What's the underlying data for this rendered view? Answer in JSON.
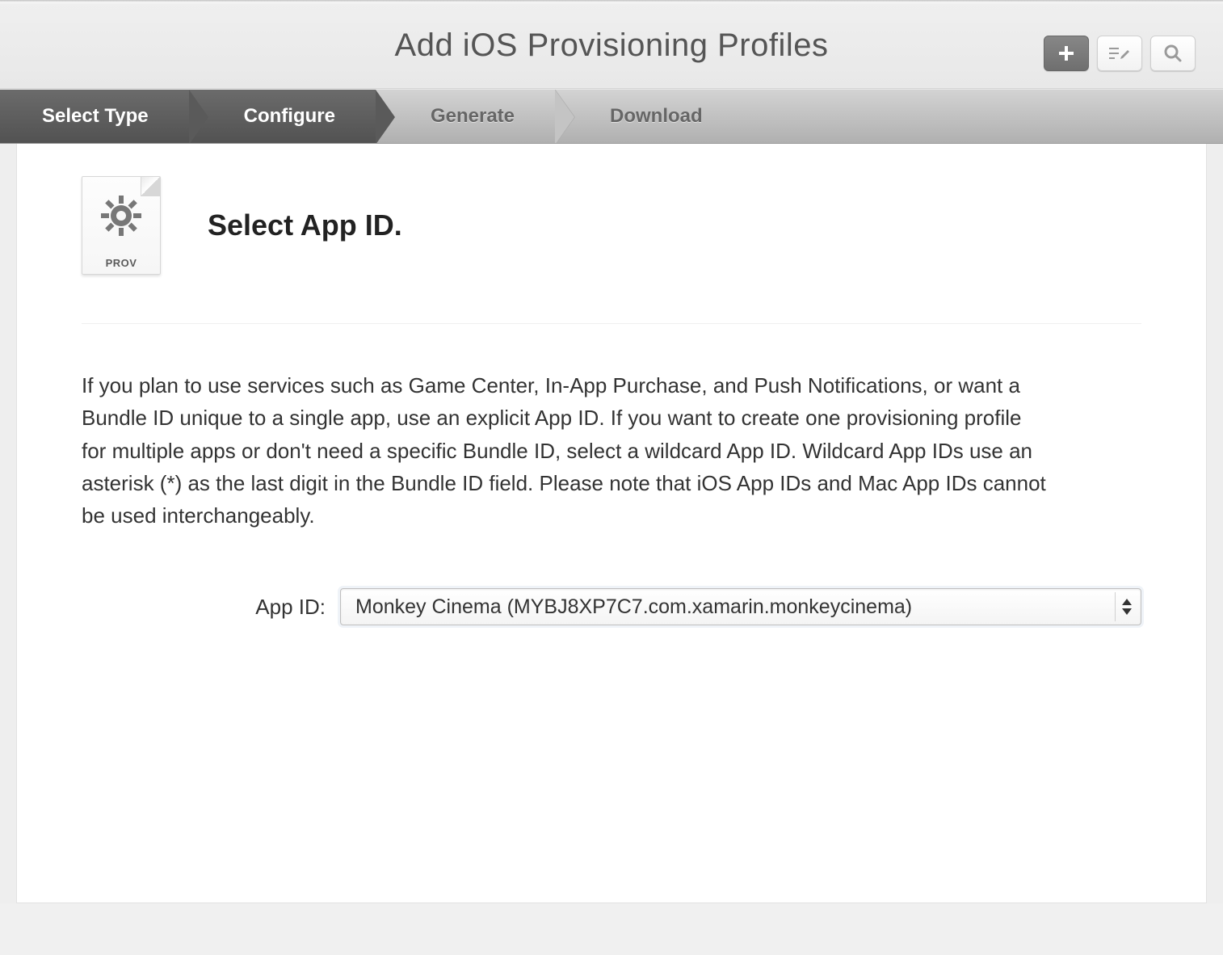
{
  "header": {
    "title": "Add iOS Provisioning Profiles"
  },
  "steps": [
    {
      "label": "Select Type",
      "active": true
    },
    {
      "label": "Configure",
      "active": true
    },
    {
      "label": "Generate",
      "active": false
    },
    {
      "label": "Download",
      "active": false
    }
  ],
  "icon": {
    "caption": "PROV"
  },
  "section": {
    "title": "Select App ID.",
    "description": "If you plan to use services such as Game Center, In-App Purchase, and Push Notifications, or want a Bundle ID unique to a single app, use an explicit App ID. If you want to create one provisioning profile for multiple apps or don't need a specific Bundle ID, select a wildcard App ID. Wildcard App IDs use an asterisk (*) as the last digit in the Bundle ID field. Please note that iOS App IDs and Mac App IDs cannot be used interchangeably."
  },
  "form": {
    "app_id_label": "App ID:",
    "app_id_value": "Monkey Cinema (MYBJ8XP7C7.com.xamarin.monkeycinema)"
  }
}
